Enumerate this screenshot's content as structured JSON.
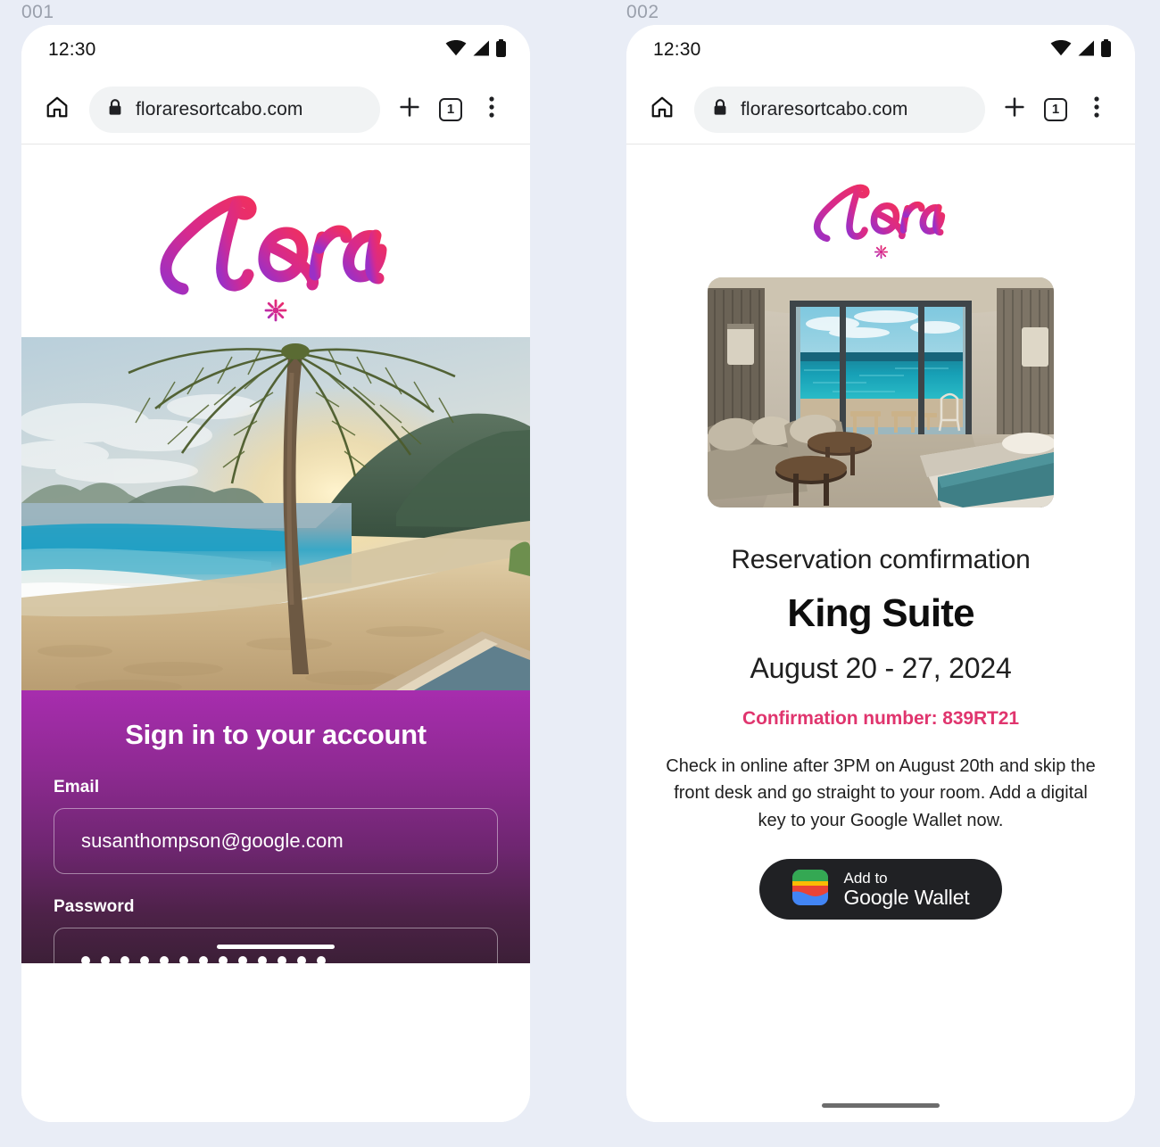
{
  "frames": [
    {
      "label": "001"
    },
    {
      "label": "002"
    }
  ],
  "colors": {
    "canvas_background": "#e9edf6",
    "frame_label": "#9aa0ac",
    "brand_pink": "#e0356e",
    "brand_magenta": "#d62a8e",
    "brand_purple": "#9b30c6",
    "panel_gradient_top": "#a72dae",
    "panel_gradient_bottom": "#3c1f37",
    "url_pill": "#f1f3f4",
    "wallet_button": "#202124"
  },
  "phone1": {
    "status": {
      "time": "12:30",
      "icons": [
        "wifi-icon",
        "cellular-signal-icon",
        "battery-icon"
      ]
    },
    "browser": {
      "home_icon": "home-icon",
      "lock_icon": "lock-icon",
      "url": "floraresortcabo.com",
      "new_tab_icon": "plus-icon",
      "tab_count": "1",
      "menu_icon": "overflow-menu-icon"
    },
    "logo": {
      "wordmark": "Flora",
      "flower_icon": "flower-asterisk-icon"
    },
    "hero": {
      "alt": "beach-palm-sunset-photo"
    },
    "signin": {
      "title": "Sign in to your account",
      "email_label": "Email",
      "email_value": "susanthompson@google.com",
      "email_placeholder": "Email",
      "password_label": "Password",
      "password_dots": 13,
      "password_placeholder": "Password"
    }
  },
  "phone2": {
    "status": {
      "time": "12:30",
      "icons": [
        "wifi-icon",
        "cellular-signal-icon",
        "battery-icon"
      ]
    },
    "browser": {
      "home_icon": "home-icon",
      "lock_icon": "lock-icon",
      "url": "floraresortcabo.com",
      "new_tab_icon": "plus-icon",
      "tab_count": "1",
      "menu_icon": "overflow-menu-icon"
    },
    "logo": {
      "wordmark": "Flora",
      "flower_icon": "flower-asterisk-icon"
    },
    "room_photo": {
      "alt": "hotel-suite-ocean-view-photo"
    },
    "confirmation": {
      "subtitle": "Reservation comfirmation",
      "room_name": "King Suite",
      "dates": "August 20 - 27, 2024",
      "confirmation_line": "Confirmation number: 839RT21",
      "body": "Check in online after 3PM on August 20th and skip the front desk and go straight to your room. Add a digital key to your Google Wallet now.",
      "wallet_button": {
        "small": "Add to",
        "big": "Google Wallet",
        "icon": "google-wallet-icon"
      }
    }
  }
}
